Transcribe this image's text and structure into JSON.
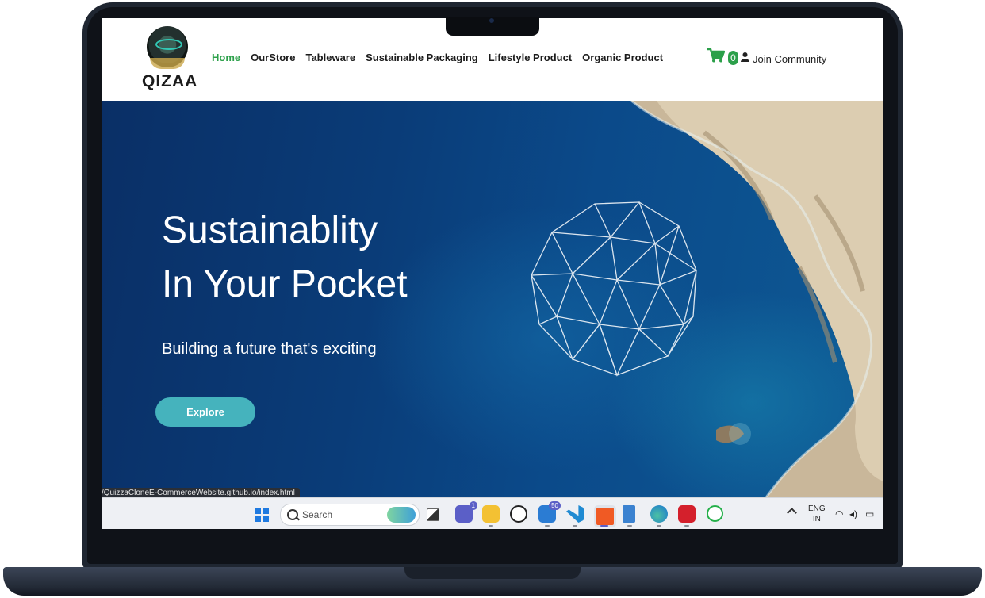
{
  "nav": {
    "brand": "QIZAA",
    "links": [
      "Home",
      "OurStore",
      "Tableware",
      "Sustainable Packaging",
      "Lifestyle Product",
      "Organic Product"
    ],
    "active_link": "Home",
    "cart_count": "0",
    "join_label": "Join Community"
  },
  "hero": {
    "title_line1": "Sustainablity",
    "title_line2": "In Your Pocket",
    "subtitle": "Building a future that's exciting",
    "cta_label": "Explore"
  },
  "status_bar_url": "/QuizzaCloneE-CommerceWebsite.github.io/index.html",
  "taskbar": {
    "search_placeholder": "Search",
    "teams_badge": "1",
    "mail_badge": "50",
    "language": "ENG",
    "region": "IN",
    "icons": [
      "windows-start-icon",
      "recycle-widget-icon",
      "task-view-icon",
      "teams-icon",
      "file-explorer-icon",
      "dell-icon",
      "mail-icon",
      "vscode-icon",
      "brave-icon",
      "notepad-icon",
      "edge-icon",
      "acrobat-icon",
      "whatsapp-icon"
    ]
  },
  "colors": {
    "accent_green": "#2ca04a",
    "button_teal": "#45b3bd",
    "sea_blue": "#0b4a8a",
    "laptop_frame": "#1f2631"
  }
}
